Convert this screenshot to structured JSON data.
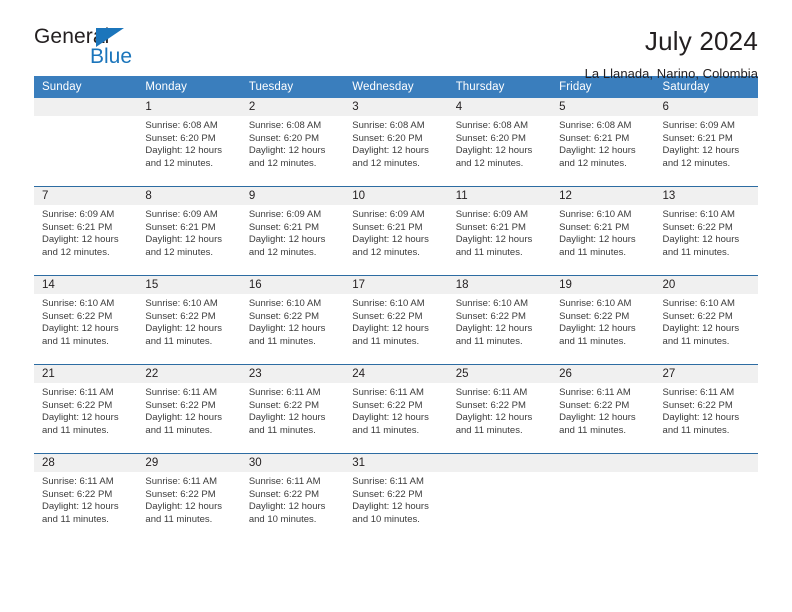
{
  "brand": {
    "name_part1": "General",
    "name_part2": "Blue",
    "triangle_color": "#1b75bb"
  },
  "header": {
    "title": "July 2024",
    "location": "La Llanada, Narino, Colombia"
  },
  "calendar": {
    "header_bg": "#3a7ebd",
    "daynum_bg": "#f0f0f0",
    "weekday_headers": [
      "Sunday",
      "Monday",
      "Tuesday",
      "Wednesday",
      "Thursday",
      "Friday",
      "Saturday"
    ],
    "weeks": [
      [
        {
          "day": "",
          "sunrise": "",
          "sunset": "",
          "daylight": ""
        },
        {
          "day": "1",
          "sunrise": "Sunrise: 6:08 AM",
          "sunset": "Sunset: 6:20 PM",
          "daylight": "Daylight: 12 hours and 12 minutes."
        },
        {
          "day": "2",
          "sunrise": "Sunrise: 6:08 AM",
          "sunset": "Sunset: 6:20 PM",
          "daylight": "Daylight: 12 hours and 12 minutes."
        },
        {
          "day": "3",
          "sunrise": "Sunrise: 6:08 AM",
          "sunset": "Sunset: 6:20 PM",
          "daylight": "Daylight: 12 hours and 12 minutes."
        },
        {
          "day": "4",
          "sunrise": "Sunrise: 6:08 AM",
          "sunset": "Sunset: 6:20 PM",
          "daylight": "Daylight: 12 hours and 12 minutes."
        },
        {
          "day": "5",
          "sunrise": "Sunrise: 6:08 AM",
          "sunset": "Sunset: 6:21 PM",
          "daylight": "Daylight: 12 hours and 12 minutes."
        },
        {
          "day": "6",
          "sunrise": "Sunrise: 6:09 AM",
          "sunset": "Sunset: 6:21 PM",
          "daylight": "Daylight: 12 hours and 12 minutes."
        }
      ],
      [
        {
          "day": "7",
          "sunrise": "Sunrise: 6:09 AM",
          "sunset": "Sunset: 6:21 PM",
          "daylight": "Daylight: 12 hours and 12 minutes."
        },
        {
          "day": "8",
          "sunrise": "Sunrise: 6:09 AM",
          "sunset": "Sunset: 6:21 PM",
          "daylight": "Daylight: 12 hours and 12 minutes."
        },
        {
          "day": "9",
          "sunrise": "Sunrise: 6:09 AM",
          "sunset": "Sunset: 6:21 PM",
          "daylight": "Daylight: 12 hours and 12 minutes."
        },
        {
          "day": "10",
          "sunrise": "Sunrise: 6:09 AM",
          "sunset": "Sunset: 6:21 PM",
          "daylight": "Daylight: 12 hours and 12 minutes."
        },
        {
          "day": "11",
          "sunrise": "Sunrise: 6:09 AM",
          "sunset": "Sunset: 6:21 PM",
          "daylight": "Daylight: 12 hours and 11 minutes."
        },
        {
          "day": "12",
          "sunrise": "Sunrise: 6:10 AM",
          "sunset": "Sunset: 6:21 PM",
          "daylight": "Daylight: 12 hours and 11 minutes."
        },
        {
          "day": "13",
          "sunrise": "Sunrise: 6:10 AM",
          "sunset": "Sunset: 6:22 PM",
          "daylight": "Daylight: 12 hours and 11 minutes."
        }
      ],
      [
        {
          "day": "14",
          "sunrise": "Sunrise: 6:10 AM",
          "sunset": "Sunset: 6:22 PM",
          "daylight": "Daylight: 12 hours and 11 minutes."
        },
        {
          "day": "15",
          "sunrise": "Sunrise: 6:10 AM",
          "sunset": "Sunset: 6:22 PM",
          "daylight": "Daylight: 12 hours and 11 minutes."
        },
        {
          "day": "16",
          "sunrise": "Sunrise: 6:10 AM",
          "sunset": "Sunset: 6:22 PM",
          "daylight": "Daylight: 12 hours and 11 minutes."
        },
        {
          "day": "17",
          "sunrise": "Sunrise: 6:10 AM",
          "sunset": "Sunset: 6:22 PM",
          "daylight": "Daylight: 12 hours and 11 minutes."
        },
        {
          "day": "18",
          "sunrise": "Sunrise: 6:10 AM",
          "sunset": "Sunset: 6:22 PM",
          "daylight": "Daylight: 12 hours and 11 minutes."
        },
        {
          "day": "19",
          "sunrise": "Sunrise: 6:10 AM",
          "sunset": "Sunset: 6:22 PM",
          "daylight": "Daylight: 12 hours and 11 minutes."
        },
        {
          "day": "20",
          "sunrise": "Sunrise: 6:10 AM",
          "sunset": "Sunset: 6:22 PM",
          "daylight": "Daylight: 12 hours and 11 minutes."
        }
      ],
      [
        {
          "day": "21",
          "sunrise": "Sunrise: 6:11 AM",
          "sunset": "Sunset: 6:22 PM",
          "daylight": "Daylight: 12 hours and 11 minutes."
        },
        {
          "day": "22",
          "sunrise": "Sunrise: 6:11 AM",
          "sunset": "Sunset: 6:22 PM",
          "daylight": "Daylight: 12 hours and 11 minutes."
        },
        {
          "day": "23",
          "sunrise": "Sunrise: 6:11 AM",
          "sunset": "Sunset: 6:22 PM",
          "daylight": "Daylight: 12 hours and 11 minutes."
        },
        {
          "day": "24",
          "sunrise": "Sunrise: 6:11 AM",
          "sunset": "Sunset: 6:22 PM",
          "daylight": "Daylight: 12 hours and 11 minutes."
        },
        {
          "day": "25",
          "sunrise": "Sunrise: 6:11 AM",
          "sunset": "Sunset: 6:22 PM",
          "daylight": "Daylight: 12 hours and 11 minutes."
        },
        {
          "day": "26",
          "sunrise": "Sunrise: 6:11 AM",
          "sunset": "Sunset: 6:22 PM",
          "daylight": "Daylight: 12 hours and 11 minutes."
        },
        {
          "day": "27",
          "sunrise": "Sunrise: 6:11 AM",
          "sunset": "Sunset: 6:22 PM",
          "daylight": "Daylight: 12 hours and 11 minutes."
        }
      ],
      [
        {
          "day": "28",
          "sunrise": "Sunrise: 6:11 AM",
          "sunset": "Sunset: 6:22 PM",
          "daylight": "Daylight: 12 hours and 11 minutes."
        },
        {
          "day": "29",
          "sunrise": "Sunrise: 6:11 AM",
          "sunset": "Sunset: 6:22 PM",
          "daylight": "Daylight: 12 hours and 11 minutes."
        },
        {
          "day": "30",
          "sunrise": "Sunrise: 6:11 AM",
          "sunset": "Sunset: 6:22 PM",
          "daylight": "Daylight: 12 hours and 10 minutes."
        },
        {
          "day": "31",
          "sunrise": "Sunrise: 6:11 AM",
          "sunset": "Sunset: 6:22 PM",
          "daylight": "Daylight: 12 hours and 10 minutes."
        },
        {
          "day": "",
          "sunrise": "",
          "sunset": "",
          "daylight": ""
        },
        {
          "day": "",
          "sunrise": "",
          "sunset": "",
          "daylight": ""
        },
        {
          "day": "",
          "sunrise": "",
          "sunset": "",
          "daylight": ""
        }
      ]
    ]
  }
}
